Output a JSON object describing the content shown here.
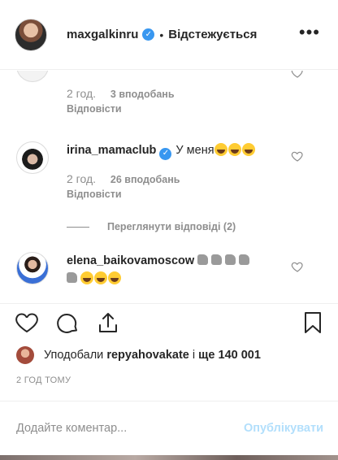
{
  "header": {
    "username": "maxgalkinru",
    "separator": "•",
    "follow_status": "Відстежується",
    "more_label": "•••"
  },
  "comments": [
    {
      "username": "",
      "text": "",
      "time": "2 год.",
      "likes": "3 вподобань",
      "reply": "Відповісти"
    },
    {
      "username": "irina_mamaclub",
      "verified": true,
      "text": "У меня",
      "emojis": [
        "grinning-squinting-face",
        "grinning-squinting-face",
        "grinning-squinting-face"
      ],
      "time": "2 год.",
      "likes": "26 вподобань",
      "reply": "Відповісти",
      "view_replies": "Переглянути відповіді (2)"
    },
    {
      "username": "elena_baikovamoscow",
      "text": "",
      "emojis": [
        "thumbs-up",
        "thumbs-up",
        "thumbs-up",
        "thumbs-up",
        "thumbs-up",
        "grinning-squinting-face",
        "grinning-squinting-face",
        "grinning-squinting-face"
      ]
    }
  ],
  "likes": {
    "prefix": "Уподобали",
    "user": "repyahovakate",
    "middle": "і",
    "count": "ще 140 001"
  },
  "time_ago": "2 ГОД ТОМУ",
  "comment_box": {
    "placeholder": "Додайте коментар...",
    "publish_label": "Опублікувати"
  },
  "colors": {
    "verified": "#3897f0",
    "secondary_text": "#8e8e8e",
    "publish_disabled": "#b2dffc"
  }
}
